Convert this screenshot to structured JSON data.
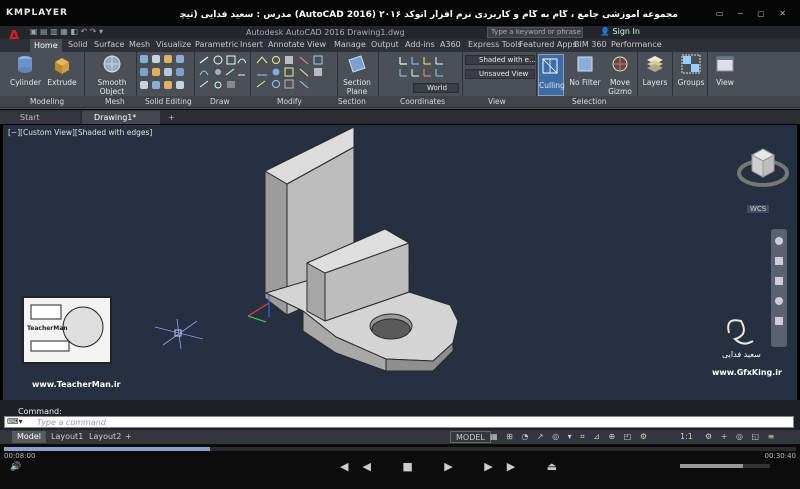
{
  "player": {
    "name": "KMPLAYER",
    "caption": "مجموعه آموزشی جامع ، گام به گام و کاربردی نرم افزار  اتوکد ۲۰۱۶ (AutoCAD 2016)  مدرس : سعید فدایی (تیچرمن) گروه آموزشی پادشاه گرافیست ها",
    "time_current": "00:08:00",
    "time_total": "00:30:40"
  },
  "app": {
    "logo": "A",
    "title": "Autodesk AutoCAD 2016   Drawing1.dwg",
    "search_placeholder": "Type a keyword or phrase",
    "signin": "Sign In"
  },
  "ribbon_tabs": [
    "Home",
    "Solid",
    "Surface",
    "Mesh",
    "Visualize",
    "Parametric",
    "Insert",
    "Annotate",
    "View",
    "Manage",
    "Output",
    "Add-ins",
    "A360",
    "Express Tools",
    "Featured Apps",
    "BIM 360",
    "Performance"
  ],
  "ribbon": {
    "cylinder": "Cylinder",
    "extrude": "Extrude",
    "smooth_object": "Smooth\nObject",
    "section_plane": "Section\nPlane",
    "visual_style": "Shaded with e...",
    "unsaved_view": "Unsaved View",
    "ucs": "World",
    "culling": "Culling",
    "no_filter": "No Filter",
    "move_gizmo": "Move\nGizmo",
    "layers": "Layers",
    "groups": "Groups",
    "view": "View",
    "panels": [
      "Modeling",
      "Mesh",
      "Solid Editing",
      "Draw",
      "Modify",
      "Section",
      "Coordinates",
      "View",
      "Selection"
    ]
  },
  "file_tabs": [
    "Start",
    "Drawing1*"
  ],
  "viewport": {
    "label": "[−][Custom View][Shaded with edges]",
    "wcs": "WCS"
  },
  "watermarks": {
    "teacher_site": "www.TeacherMan.ir",
    "teacher_badge": "TeacherMan",
    "gfx_site": "www.GfxKing.ir",
    "gfx_name": "سعید فدایی"
  },
  "command": {
    "label": "Command:",
    "placeholder": "Type a command"
  },
  "layout_tabs": [
    "Model",
    "Layout1",
    "Layout2"
  ],
  "status": {
    "model": "MODEL",
    "scale": "1:1"
  },
  "colors": {
    "ribbon": "#4b5057",
    "viewport": "#263040",
    "solid": "#bcbcbc",
    "accent": "#d21f1f"
  }
}
